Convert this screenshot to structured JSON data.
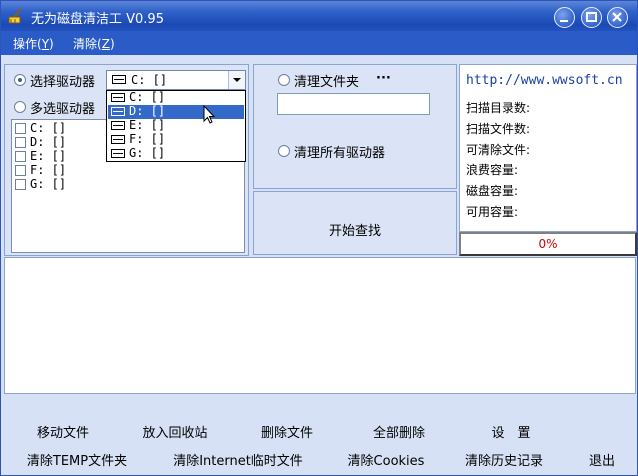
{
  "window": {
    "title": "无为磁盘清洁工 V0.95",
    "title_bar_color": "#2a5bc7",
    "icon": "broom-icon"
  },
  "menu": {
    "operate_label": "操作",
    "operate_key": "Y",
    "clear_label": "清除",
    "clear_key": "Z"
  },
  "drives": {
    "select_drive_label": "选择驱动器",
    "multi_drive_label": "多选驱动器",
    "selected_mode": "select",
    "combo_value": "C: []",
    "dropdown_options": [
      "C: []",
      "D: []",
      "E: []",
      "F: []",
      "G: []"
    ],
    "highlighted_option_index": 1,
    "multi_list": [
      "C: []",
      "D: []",
      "E: []",
      "F: []",
      "G: []"
    ]
  },
  "cleanup": {
    "clean_folder_label": "清理文件夹",
    "browse_label": "···",
    "folder_value": "",
    "clean_all_label": "清理所有驱动器",
    "start_label": "开始查找"
  },
  "info": {
    "url": "http://www.wwsoft.cn",
    "stats": [
      "扫描目录数:",
      "扫描文件数:",
      "可清除文件:",
      "浪费容量:",
      "磁盘容量:",
      "可用容量:"
    ],
    "progress_text": "0%",
    "progress_color": "#d00000"
  },
  "actions_row1": [
    "移动文件",
    "放入回收站",
    "删除文件",
    "全部删除",
    "设　置"
  ],
  "actions_row2": [
    "清除TEMP文件夹",
    "清除Internet临时文件",
    "清除Cookies",
    "清除历史记录",
    "退出"
  ]
}
